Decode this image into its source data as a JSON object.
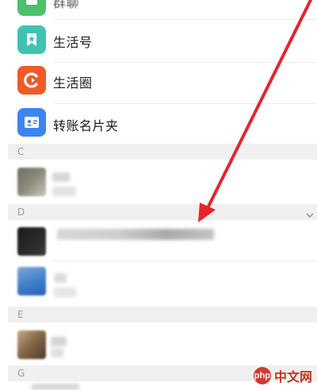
{
  "list": {
    "top_item_label": "群聊",
    "items": [
      {
        "label": "生活号",
        "icon": "ribbon-star-icon",
        "color": "#3fc3b3"
      },
      {
        "label": "生活圈",
        "icon": "circle-c-icon",
        "color": "#f15a26"
      },
      {
        "label": "转账名片夹",
        "icon": "contact-card-icon",
        "color": "#3d86f0"
      }
    ]
  },
  "sections": {
    "c": "C",
    "d": "D",
    "e": "E",
    "g": "G"
  },
  "watermark": {
    "badge": "php",
    "text": "中文网"
  },
  "colors": {
    "arrow": "#e8242b",
    "section_bg": "#f0f0f0",
    "green": "#4cc06a"
  }
}
